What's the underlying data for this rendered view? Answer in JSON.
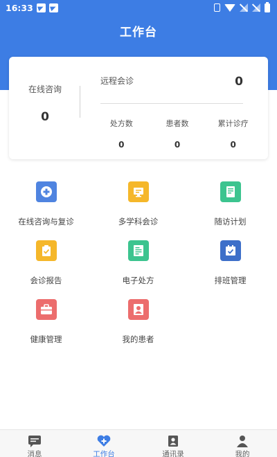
{
  "status_bar": {
    "time": "16:33"
  },
  "header": {
    "title": "工作台"
  },
  "stats": {
    "online": {
      "label": "在线咨询",
      "value": "0"
    },
    "remote": {
      "label": "远程会诊",
      "value": "0"
    },
    "sub": [
      {
        "label": "处方数",
        "value": "0"
      },
      {
        "label": "患者数",
        "value": "0"
      },
      {
        "label": "累计诊疗",
        "value": "0"
      }
    ]
  },
  "grid": [
    {
      "label": "在线咨询与复诊",
      "icon": "medical-cross-icon",
      "color": "#4f84e0"
    },
    {
      "label": "多学科会诊",
      "icon": "monitor-icon",
      "color": "#f5b72a"
    },
    {
      "label": "随访计划",
      "icon": "document-icon",
      "color": "#3cc48f"
    },
    {
      "label": "会诊报告",
      "icon": "clipboard-icon",
      "color": "#f5b72a"
    },
    {
      "label": "电子处方",
      "icon": "prescription-icon",
      "color": "#3cc48f"
    },
    {
      "label": "排班管理",
      "icon": "calendar-icon",
      "color": "#3d6fc9"
    },
    {
      "label": "健康管理",
      "icon": "medical-kit-icon",
      "color": "#ec6d6d"
    },
    {
      "label": "我的患者",
      "icon": "patient-icon",
      "color": "#ec6d6d"
    }
  ],
  "tabbar": {
    "items": [
      {
        "label": "消息",
        "icon": "message-icon",
        "active": false
      },
      {
        "label": "工作台",
        "icon": "workbench-icon",
        "active": true
      },
      {
        "label": "通讯录",
        "icon": "contacts-icon",
        "active": false
      },
      {
        "label": "我的",
        "icon": "profile-icon",
        "active": false
      }
    ]
  },
  "colors": {
    "primary": "#3d7de4",
    "tab_inactive": "#555555"
  }
}
